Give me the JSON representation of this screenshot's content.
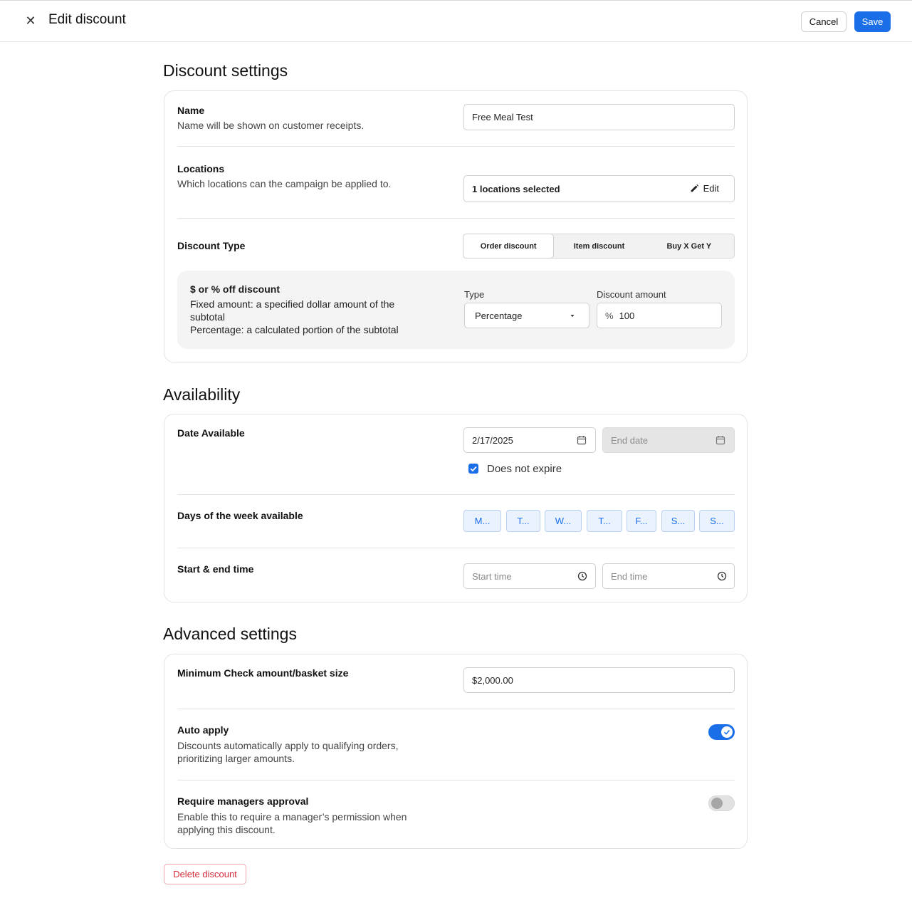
{
  "header": {
    "title": "Edit discount",
    "cancel_label": "Cancel",
    "save_label": "Save"
  },
  "discount_settings": {
    "title": "Discount settings",
    "name": {
      "label": "Name",
      "description": "Name will be shown on customer receipts.",
      "value": "Free Meal Test"
    },
    "locations": {
      "label": "Locations",
      "description": "Which locations can the campaign be applied to.",
      "value": "1 locations selected",
      "edit_label": "Edit"
    },
    "discount_type": {
      "label": "Discount Type",
      "options": [
        "Order discount",
        "Item discount",
        "Buy X Get Y"
      ],
      "selected": "Order discount"
    },
    "off_discount": {
      "title": "$ or % off discount",
      "line1": "Fixed amount: a specified dollar amount of the",
      "line2": "subtotal",
      "line3": "Percentage: a calculated portion of the subtotal",
      "type_label": "Type",
      "type_value": "Percentage",
      "amount_label": "Discount amount",
      "amount_prefix": "%",
      "amount_value": "100"
    }
  },
  "availability": {
    "title": "Availability",
    "date": {
      "label": "Date Available",
      "start_value": "2/17/2025",
      "end_placeholder": "End date",
      "no_expire_label": "Does not expire",
      "no_expire_checked": true
    },
    "days": {
      "label": "Days of the week available",
      "items": [
        "M...",
        "T...",
        "W...",
        "T...",
        "F...",
        "S...",
        "S..."
      ]
    },
    "time": {
      "label": "Start & end time",
      "start_placeholder": "Start time",
      "end_placeholder": "End time"
    }
  },
  "advanced": {
    "title": "Advanced settings",
    "min_check": {
      "label": "Minimum Check amount/basket size",
      "value": "$2,000.00"
    },
    "auto_apply": {
      "label": "Auto apply",
      "line1": "Discounts automatically apply to qualifying orders,",
      "line2": "prioritizing larger amounts.",
      "enabled": true
    },
    "manager_approval": {
      "label": "Require managers approval",
      "line1": "Enable this to require a manager’s permission when",
      "line2": "applying this discount.",
      "enabled": false
    }
  },
  "delete_label": "Delete discount",
  "colors": {
    "accent": "#1a6ee8",
    "danger": "#d62b3a"
  }
}
